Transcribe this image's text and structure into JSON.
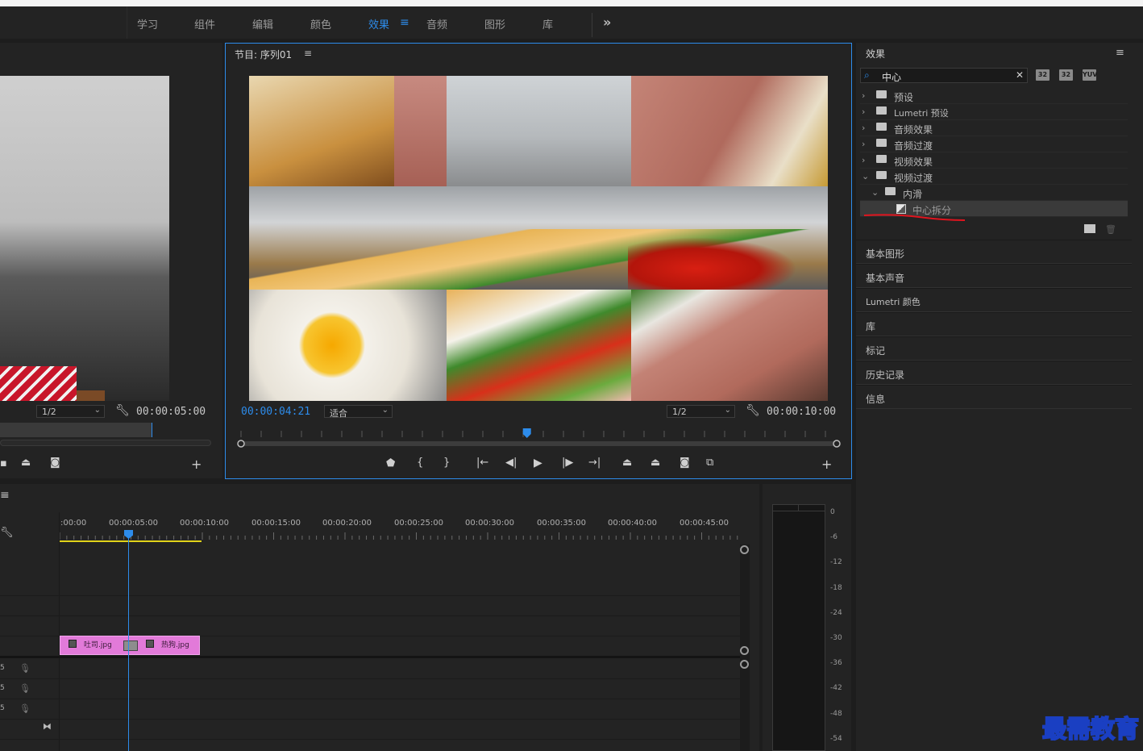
{
  "workspace_tabs": [
    "学习",
    "组件",
    "编辑",
    "颜色",
    "效果",
    "音频",
    "图形",
    "库"
  ],
  "active_tab": "效果",
  "source_monitor": {
    "zoom": "1/2",
    "timecode": "00:00:05:00"
  },
  "program_monitor": {
    "title": "节目: 序列01",
    "current_time": "00:00:04:21",
    "fit": "适合",
    "zoom": "1/2",
    "duration": "00:00:10:00",
    "playhead_fraction": 0.48
  },
  "effects_panel": {
    "title": "效果",
    "search_value": "中心",
    "badges": [
      "32",
      "32",
      "YUV"
    ],
    "tree": [
      {
        "label": "预设",
        "level": 0,
        "expanded": false
      },
      {
        "label": "Lumetri 预设",
        "level": 0,
        "expanded": false
      },
      {
        "label": "音频效果",
        "level": 0,
        "expanded": false
      },
      {
        "label": "音频过渡",
        "level": 0,
        "expanded": false
      },
      {
        "label": "视频效果",
        "level": 0,
        "expanded": false
      },
      {
        "label": "视频过渡",
        "level": 0,
        "expanded": true
      },
      {
        "label": "内滑",
        "level": 1,
        "expanded": true
      },
      {
        "label": "中心拆分",
        "level": 2,
        "selected": true
      }
    ],
    "sections": [
      "基本图形",
      "基本声音",
      "Lumetri 颜色",
      "库",
      "标记",
      "历史记录",
      "信息"
    ]
  },
  "timeline": {
    "ruler_labels": [
      ":00:00",
      "00:00:05:00",
      "00:00:10:00",
      "00:00:15:00",
      "00:00:20:00",
      "00:00:25:00",
      "00:00:30:00",
      "00:00:35:00",
      "00:00:40:00",
      "00:00:45:00"
    ],
    "clips": [
      {
        "name": "吐司.jpg"
      },
      {
        "name": "热狗.jpg"
      }
    ],
    "track_labels": [
      "5",
      "5",
      "5"
    ]
  },
  "audio_meter": {
    "db_labels": [
      "0",
      "-6",
      "-12",
      "-18",
      "-24",
      "-30",
      "-36",
      "-42",
      "-48",
      "-54"
    ]
  },
  "watermark": "最需教育",
  "colors": {
    "accent": "#2d8ceb",
    "clip": "#e27ad9",
    "annotation": "#e0141e"
  }
}
